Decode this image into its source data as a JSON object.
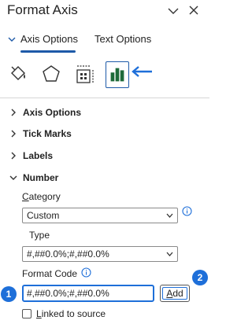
{
  "title": "Format Axis",
  "tabs": {
    "axis_options": "Axis Options",
    "text_options": "Text Options"
  },
  "icons": [
    "fill-line-icon",
    "effects-icon",
    "size-properties-icon",
    "axis-options-icon"
  ],
  "sections": {
    "axis_options": "Axis Options",
    "tick_marks": "Tick Marks",
    "labels": "Labels",
    "number": "Number"
  },
  "number": {
    "category_label_first": "C",
    "category_label_rest": "ategory",
    "category_value": "Custom",
    "type_label": "Type",
    "type_value": "#,##0.0%;#,##0.0%",
    "format_code_label": "Format Code",
    "format_code_value": "#,##0.0%;#,##0.0%",
    "add_label_first": "A",
    "add_label_rest": "dd",
    "linked_label_first": "L",
    "linked_label_rest": "inked to source",
    "linked_checked": false
  },
  "annotations": {
    "badge1": "1",
    "badge2": "2"
  },
  "colors": {
    "accent": "#1e5aa8",
    "callout": "#1e6fd9",
    "chart_icon": "#1e6b3a"
  }
}
